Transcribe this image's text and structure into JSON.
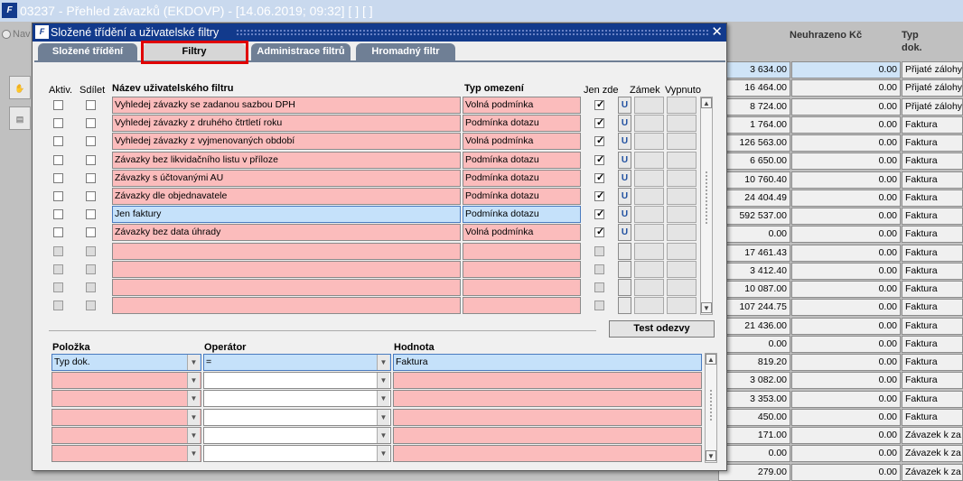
{
  "app": {
    "title": "03237 - Přehled závazků (EKDOVP) - [14.06.2019; 09:32]  [ ]  [ ]",
    "logo": "F",
    "nav_label": "Nav"
  },
  "background_table": {
    "headers": {
      "neuhrazeno": "Neuhrazeno Kč",
      "typ": "Typ\ndok."
    },
    "rows": [
      {
        "amount": "3 634.00",
        "neuhrazeno": "0.00",
        "typ": "Přijaté zálohy"
      },
      {
        "amount": "16 464.00",
        "neuhrazeno": "0.00",
        "typ": "Přijaté zálohy"
      },
      {
        "amount": "8 724.00",
        "neuhrazeno": "0.00",
        "typ": "Přijaté zálohy"
      },
      {
        "amount": "1 764.00",
        "neuhrazeno": "0.00",
        "typ": "Faktura"
      },
      {
        "amount": "126 563.00",
        "neuhrazeno": "0.00",
        "typ": "Faktura"
      },
      {
        "amount": "6 650.00",
        "neuhrazeno": "0.00",
        "typ": "Faktura"
      },
      {
        "amount": "10 760.40",
        "neuhrazeno": "0.00",
        "typ": "Faktura"
      },
      {
        "amount": "24 404.49",
        "neuhrazeno": "0.00",
        "typ": "Faktura"
      },
      {
        "amount": "592 537.00",
        "neuhrazeno": "0.00",
        "typ": "Faktura"
      },
      {
        "amount": "0.00",
        "neuhrazeno": "0.00",
        "typ": "Faktura"
      },
      {
        "amount": "17 461.43",
        "neuhrazeno": "0.00",
        "typ": "Faktura"
      },
      {
        "amount": "3 412.40",
        "neuhrazeno": "0.00",
        "typ": "Faktura"
      },
      {
        "amount": "10 087.00",
        "neuhrazeno": "0.00",
        "typ": "Faktura"
      },
      {
        "amount": "107 244.75",
        "neuhrazeno": "0.00",
        "typ": "Faktura"
      },
      {
        "amount": "21 436.00",
        "neuhrazeno": "0.00",
        "typ": "Faktura"
      },
      {
        "amount": "0.00",
        "neuhrazeno": "0.00",
        "typ": "Faktura"
      },
      {
        "amount": "819.20",
        "neuhrazeno": "0.00",
        "typ": "Faktura"
      },
      {
        "amount": "3 082.00",
        "neuhrazeno": "0.00",
        "typ": "Faktura"
      },
      {
        "amount": "3 353.00",
        "neuhrazeno": "0.00",
        "typ": "Faktura"
      },
      {
        "amount": "450.00",
        "neuhrazeno": "0.00",
        "typ": "Faktura"
      },
      {
        "amount": "171.00",
        "neuhrazeno": "0.00",
        "typ": "Závazek k za"
      },
      {
        "amount": "0.00",
        "neuhrazeno": "0.00",
        "typ": "Závazek k za"
      },
      {
        "amount": "279.00",
        "neuhrazeno": "0.00",
        "typ": "Závazek k za"
      }
    ]
  },
  "dialog": {
    "title": "Složené třídění a uživatelské filtry",
    "close_glyph": "✕",
    "tabs": [
      {
        "label": "Složené třídění",
        "active": false
      },
      {
        "label": "Filtry",
        "active": true
      },
      {
        "label": "Administrace filtrů",
        "active": false
      },
      {
        "label": "Hromadný filtr",
        "active": false
      }
    ],
    "columns": {
      "aktiv": "Aktiv.",
      "sdilet": "Sdílet",
      "nazev": "Název uživatelského filtru",
      "typ": "Typ omezení",
      "jen_zde": "Jen zde",
      "zamek": "Zámek",
      "vypnuto": "Vypnuto"
    },
    "u_label": "U",
    "filters": [
      {
        "name": "Vyhledej závazky se zadanou sazbou DPH",
        "type": "Volná podmínka",
        "jen_zde": true
      },
      {
        "name": "Vyhledej závazky z druhého čtrtletí roku",
        "type": "Podmínka dotazu",
        "jen_zde": true
      },
      {
        "name": "Vyhledej závazky z vyjmenovaných období",
        "type": "Volná podmínka",
        "jen_zde": true
      },
      {
        "name": "Závazky bez likvidačního listu v příloze",
        "type": "Podmínka dotazu",
        "jen_zde": true
      },
      {
        "name": "Závazky s účtovanými AU",
        "type": "Podmínka dotazu",
        "jen_zde": true
      },
      {
        "name": "Závazky dle objednavatele",
        "type": "Podmínka dotazu",
        "jen_zde": true
      },
      {
        "name": "Jen faktury",
        "type": "Podmínka dotazu",
        "jen_zde": true,
        "selected": true
      },
      {
        "name": "Závazky bez data úhrady",
        "type": "Volná podmínka",
        "jen_zde": true
      },
      {
        "name": "",
        "type": "",
        "jen_zde": false
      },
      {
        "name": "",
        "type": "",
        "jen_zde": false
      },
      {
        "name": "",
        "type": "",
        "jen_zde": false
      },
      {
        "name": "",
        "type": "",
        "jen_zde": false
      }
    ],
    "test_button": "Test odezvy",
    "conditions_columns": {
      "polozka": "Položka",
      "operator": "Operátor",
      "hodnota": "Hodnota"
    },
    "conditions": [
      {
        "polozka": "Typ  dok.",
        "operator": "=",
        "hodnota": "Faktura"
      },
      {
        "polozka": "",
        "operator": "",
        "hodnota": ""
      },
      {
        "polozka": "",
        "operator": "",
        "hodnota": ""
      },
      {
        "polozka": "",
        "operator": "",
        "hodnota": ""
      },
      {
        "polozka": "",
        "operator": "",
        "hodnota": ""
      },
      {
        "polozka": "",
        "operator": "",
        "hodnota": ""
      }
    ]
  }
}
